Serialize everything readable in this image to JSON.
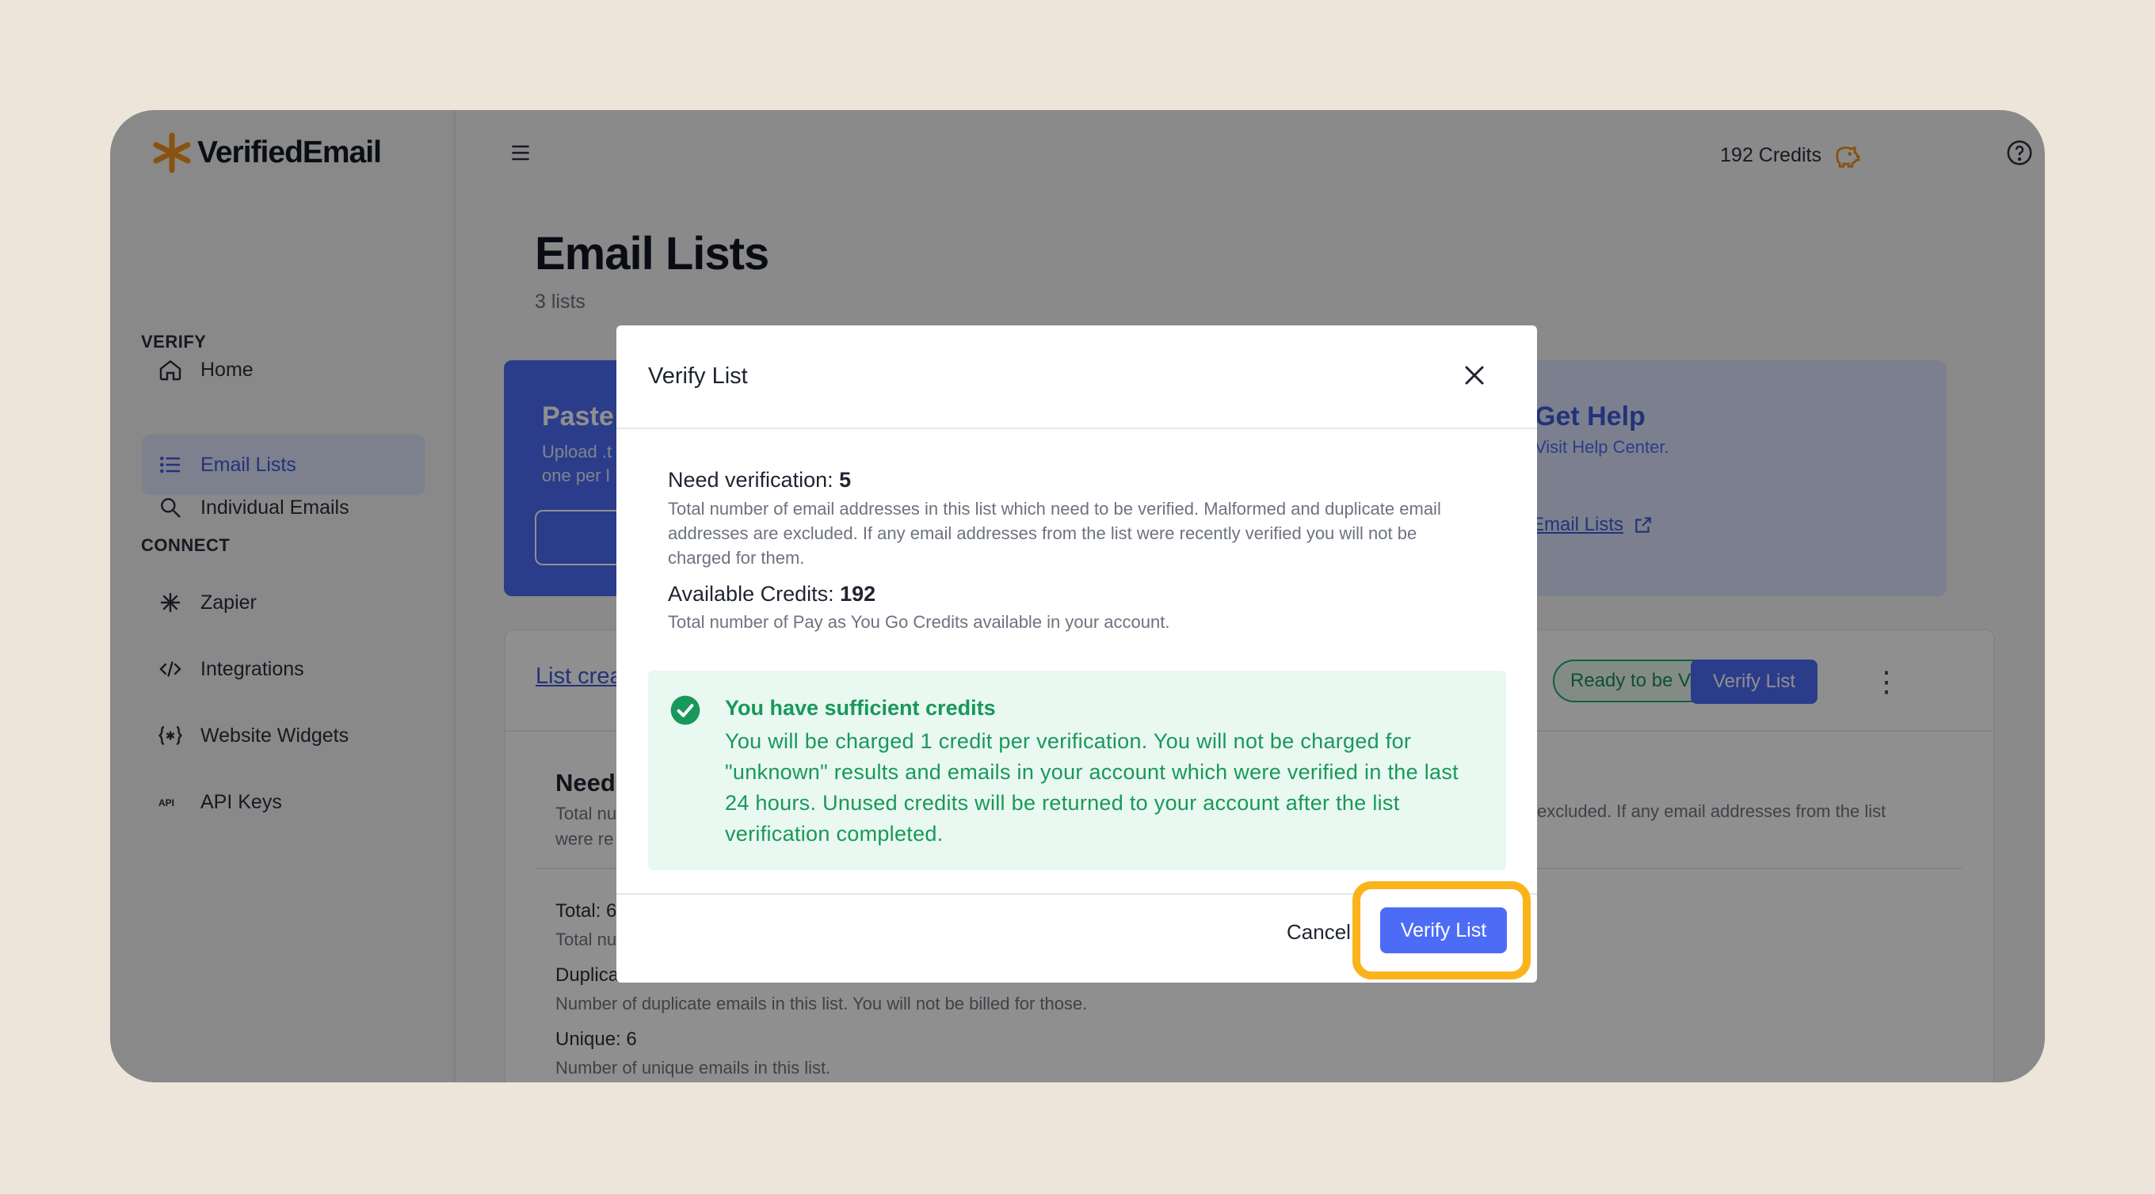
{
  "app": {
    "name": "VerifiedEmail"
  },
  "sidebar": {
    "home": "Home",
    "verify_section": "VERIFY",
    "verify_items": [
      {
        "label": "Individual Emails",
        "icon": "search-icon"
      },
      {
        "label": "Email Lists",
        "icon": "list-icon",
        "active": true
      }
    ],
    "connect_section": "CONNECT",
    "connect_items": [
      {
        "label": "Zapier",
        "icon": "asterisk-icon"
      },
      {
        "label": "Integrations",
        "icon": "code-icon"
      },
      {
        "label": "Website Widgets",
        "icon": "widget-icon"
      },
      {
        "label": "API Keys",
        "icon": "api-icon"
      }
    ]
  },
  "topbar": {
    "credits": "192 Credits"
  },
  "page": {
    "title": "Email Lists",
    "subtitle": "3 lists"
  },
  "cards": {
    "paste_title": "Paste",
    "paste_sub": "Upload .t",
    "paste_sub2": "one per l",
    "help_title": "Get Help",
    "help_sub": "Visit Help Center.",
    "help_link": "Email Lists"
  },
  "list_card": {
    "link": "List crea",
    "status": "Ready to be Verified",
    "verify_button": "Verify List",
    "need_title": "Need",
    "need_desc_1": "Total nu",
    "need_desc_2": "were re",
    "need_desc_right": "excluded. If any email addresses from the list",
    "total_label": "Total: 6",
    "total_desc": "Total nu",
    "dup_label": "Duplica",
    "dup_desc": "Number of duplicate emails in this list. You will not be billed for those.",
    "unique_label": "Unique: 6",
    "unique_desc": "Number of unique emails in this list."
  },
  "modal": {
    "title": "Verify List",
    "need_label": "Need verification: ",
    "need_value": "5",
    "need_desc": "Total number of email addresses in this list which need to be verified. Malformed and duplicate email addresses are excluded. If any email addresses from the list were recently verified you will not be charged for them.",
    "credits_label": "Available Credits: ",
    "credits_value": "192",
    "credits_desc": "Total number of Pay as You Go Credits available in your account.",
    "success_title": "You have sufficient credits",
    "success_body": "You will be charged 1 credit per verification. You will not be charged for \"unknown\" results and emails in your account which were verified in the last 24 hours. Unused credits will be returned to your account after the list verification completed.",
    "cancel": "Cancel",
    "confirm": "Verify List"
  },
  "colors": {
    "accent": "#4d6cf6",
    "success": "#18985b",
    "highlight": "#fbb31a"
  }
}
